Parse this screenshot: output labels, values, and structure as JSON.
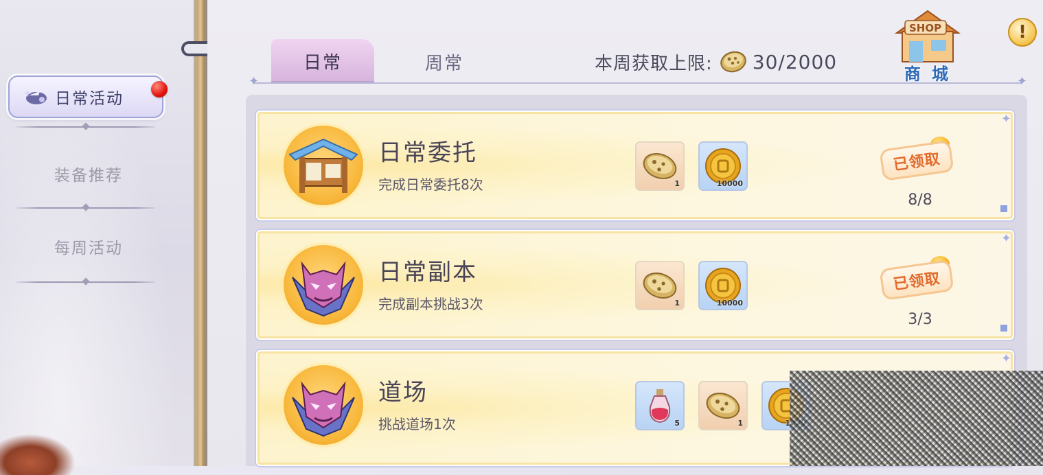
{
  "sidebar": {
    "items": [
      {
        "label": "日常活动",
        "active": true,
        "icon": "wand-icon",
        "has_notification": true
      },
      {
        "label": "装备推荐",
        "active": false
      },
      {
        "label": "每周活动",
        "active": false
      }
    ]
  },
  "header": {
    "tabs": [
      {
        "label": "日常",
        "active": true
      },
      {
        "label": "周常",
        "active": false
      }
    ],
    "weekly_limit": {
      "label": "本周获取上限:",
      "icon": "cookie-currency-icon",
      "value": "30/2000"
    },
    "shop": {
      "icon_text": "SHOP",
      "label": "商 城"
    },
    "info_icon": "!"
  },
  "tasks": [
    {
      "title": "日常委托",
      "desc": "完成日常委托8次",
      "emblem": "notice-board-icon",
      "rewards": [
        {
          "icon": "cookie-currency-icon",
          "qty": "1",
          "style": "beige"
        },
        {
          "icon": "gold-coin-icon",
          "qty": "10000",
          "style": "blue"
        }
      ],
      "status": "已领取",
      "progress": "8/8"
    },
    {
      "title": "日常副本",
      "desc": "完成副本挑战3次",
      "emblem": "demon-mask-icon",
      "rewards": [
        {
          "icon": "cookie-currency-icon",
          "qty": "1",
          "style": "beige"
        },
        {
          "icon": "gold-coin-icon",
          "qty": "10000",
          "style": "blue"
        }
      ],
      "status": "已领取",
      "progress": "3/3"
    },
    {
      "title": "道场",
      "desc": "挑战道场1次",
      "emblem": "demon-mask-icon",
      "rewards": [
        {
          "icon": "potion-icon",
          "qty": "5",
          "style": "blue"
        },
        {
          "icon": "cookie-currency-icon",
          "qty": "1",
          "style": "beige"
        },
        {
          "icon": "gold-coin-icon",
          "qty": "1000",
          "style": "blue"
        }
      ]
    }
  ],
  "colors": {
    "accent_tab": "#d6b3dd",
    "card_bg": "#fdf3cd",
    "claimed_text": "#e26a2d",
    "shop_label": "#2e6ab8"
  }
}
